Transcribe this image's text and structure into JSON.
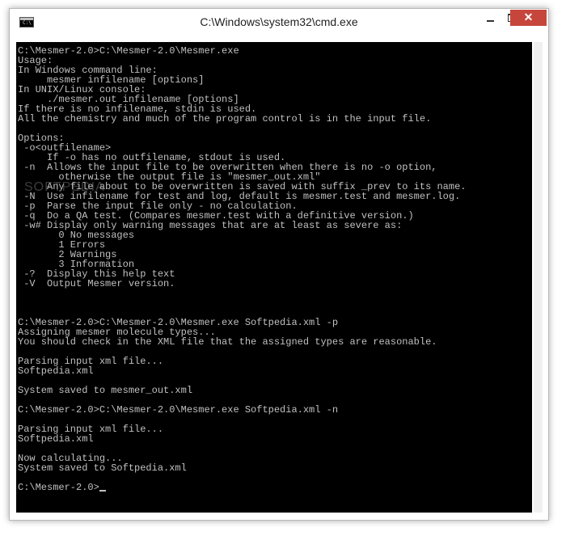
{
  "window": {
    "title": "C:\\Windows\\system32\\cmd.exe"
  },
  "icons": {
    "app": "cmd-icon",
    "minimize": "minimize-icon",
    "maximize": "maximize-icon",
    "close": "close-icon"
  },
  "colors": {
    "console_bg": "#000000",
    "console_fg": "#c0c0c0",
    "close_button": "#c7463c"
  },
  "watermark": "SOFTPEDIA",
  "console": {
    "lines": [
      "C:\\Mesmer-2.0>C:\\Mesmer-2.0\\Mesmer.exe",
      "Usage:",
      "In Windows command line:",
      "     mesmer infilename [options]",
      "In UNIX/Linux console:",
      "     ./mesmer.out infilename [options]",
      "If there is no infilename, stdin is used.",
      "All the chemistry and much of the program control is in the input file.",
      "",
      "Options:",
      " -o<outfilename>",
      "     If -o has no outfilename, stdout is used.",
      " -n  Allows the input file to be overwritten when there is no -o option,",
      "       otherwise the output file is \"mesmer_out.xml\"",
      "     Any file about to be overwritten is saved with suffix _prev to its name.",
      " -N  Use infilename for test and log, default is mesmer.test and mesmer.log.",
      " -p  Parse the input file only - no calculation.",
      " -q  Do a QA test. (Compares mesmer.test with a definitive version.)",
      " -w# Display only warning messages that are at least as severe as:",
      "       0 No messages",
      "       1 Errors",
      "       2 Warnings",
      "       3 Information",
      " -?  Display this help text",
      " -V  Output Mesmer version.",
      "",
      "",
      "",
      "C:\\Mesmer-2.0>C:\\Mesmer-2.0\\Mesmer.exe Softpedia.xml -p",
      "Assigning mesmer molecule types...",
      "You should check in the XML file that the assigned types are reasonable.",
      "",
      "Parsing input xml file...",
      "Softpedia.xml",
      "",
      "System saved to mesmer_out.xml",
      "",
      "C:\\Mesmer-2.0>C:\\Mesmer-2.0\\Mesmer.exe Softpedia.xml -n",
      "",
      "Parsing input xml file...",
      "Softpedia.xml",
      "",
      "Now calculating...",
      "System saved to Softpedia.xml",
      "",
      "C:\\Mesmer-2.0>"
    ]
  }
}
